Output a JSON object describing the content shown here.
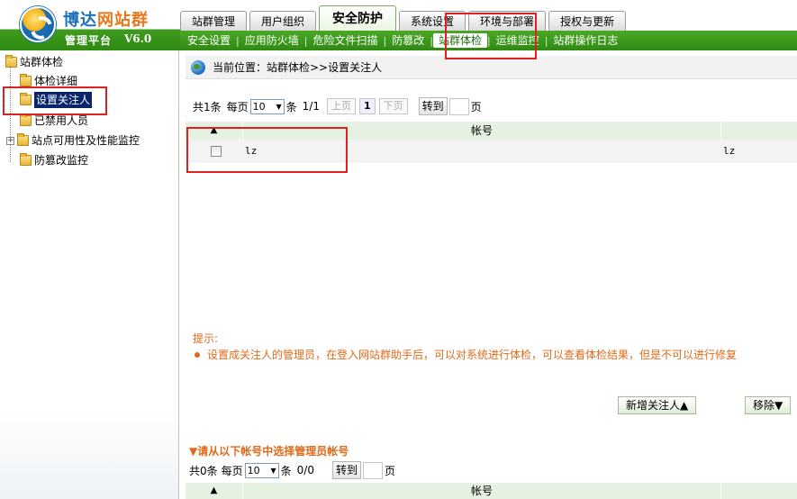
{
  "brand": {
    "name_part1": "博达",
    "name_part2": "网站群",
    "platform": "管理平台",
    "version": "V6.0"
  },
  "top_tabs": [
    {
      "label": "站群管理",
      "active": false
    },
    {
      "label": "用户组织",
      "active": false
    },
    {
      "label": "安全防护",
      "active": true
    },
    {
      "label": "系统设置",
      "active": false
    },
    {
      "label": "环境与部署",
      "active": false
    },
    {
      "label": "授权与更新",
      "active": false
    }
  ],
  "subnav": [
    {
      "label": "安全设置",
      "active": false
    },
    {
      "label": "应用防火墙",
      "active": false
    },
    {
      "label": "危险文件扫描",
      "active": false
    },
    {
      "label": "防篡改",
      "active": false
    },
    {
      "label": "站群体检",
      "active": true
    },
    {
      "label": "运维监控",
      "active": false
    },
    {
      "label": "站群操作日志",
      "active": false
    }
  ],
  "sidebar": {
    "root": "站群体检",
    "items": [
      {
        "label": "体检详细"
      },
      {
        "label": "设置关注人",
        "selected": true
      },
      {
        "label": "已禁用人员"
      },
      {
        "label": "站点可用性及性能监控",
        "expandable": true
      },
      {
        "label": "防篡改监控"
      }
    ]
  },
  "breadcrumb": {
    "text": "当前位置：站群体检>>设置关注人"
  },
  "watchers_pager": {
    "total": "共1条",
    "per_page_label": "每页",
    "per_page_value": "10",
    "per_page_suffix": "条",
    "page_status": "1/1",
    "prev": "上页",
    "current": "1",
    "next": "下页",
    "goto": "转到",
    "goto_suffix": "页"
  },
  "watchers_table": {
    "sort_arrow": "▲",
    "column": "帐号",
    "rows": [
      {
        "account": "lz",
        "account_right": "lz"
      }
    ]
  },
  "tips": {
    "title": "提示:",
    "line": "设置成关注人的管理员，在登入网站群助手后，可以对系统进行体检，可以查看体检结果，但是不可以进行修复"
  },
  "actions": {
    "add": "新增关注人▲",
    "remove": "移除▼"
  },
  "candidates": {
    "title": "▼请从以下帐号中选择管理员帐号",
    "pager": {
      "total": "共0条",
      "per_page_label": "每页",
      "per_page_value": "10",
      "per_page_suffix": "条",
      "page_status": "0/0",
      "goto": "转到",
      "goto_suffix": "页"
    },
    "table": {
      "sort_arrow": "▲",
      "column": "帐号"
    }
  },
  "colors": {
    "brand_green": "#3f9c1e",
    "brand_blue": "#1d6fb8",
    "tip_orange": "#e06a1a",
    "highlight_red": "#e02020"
  }
}
